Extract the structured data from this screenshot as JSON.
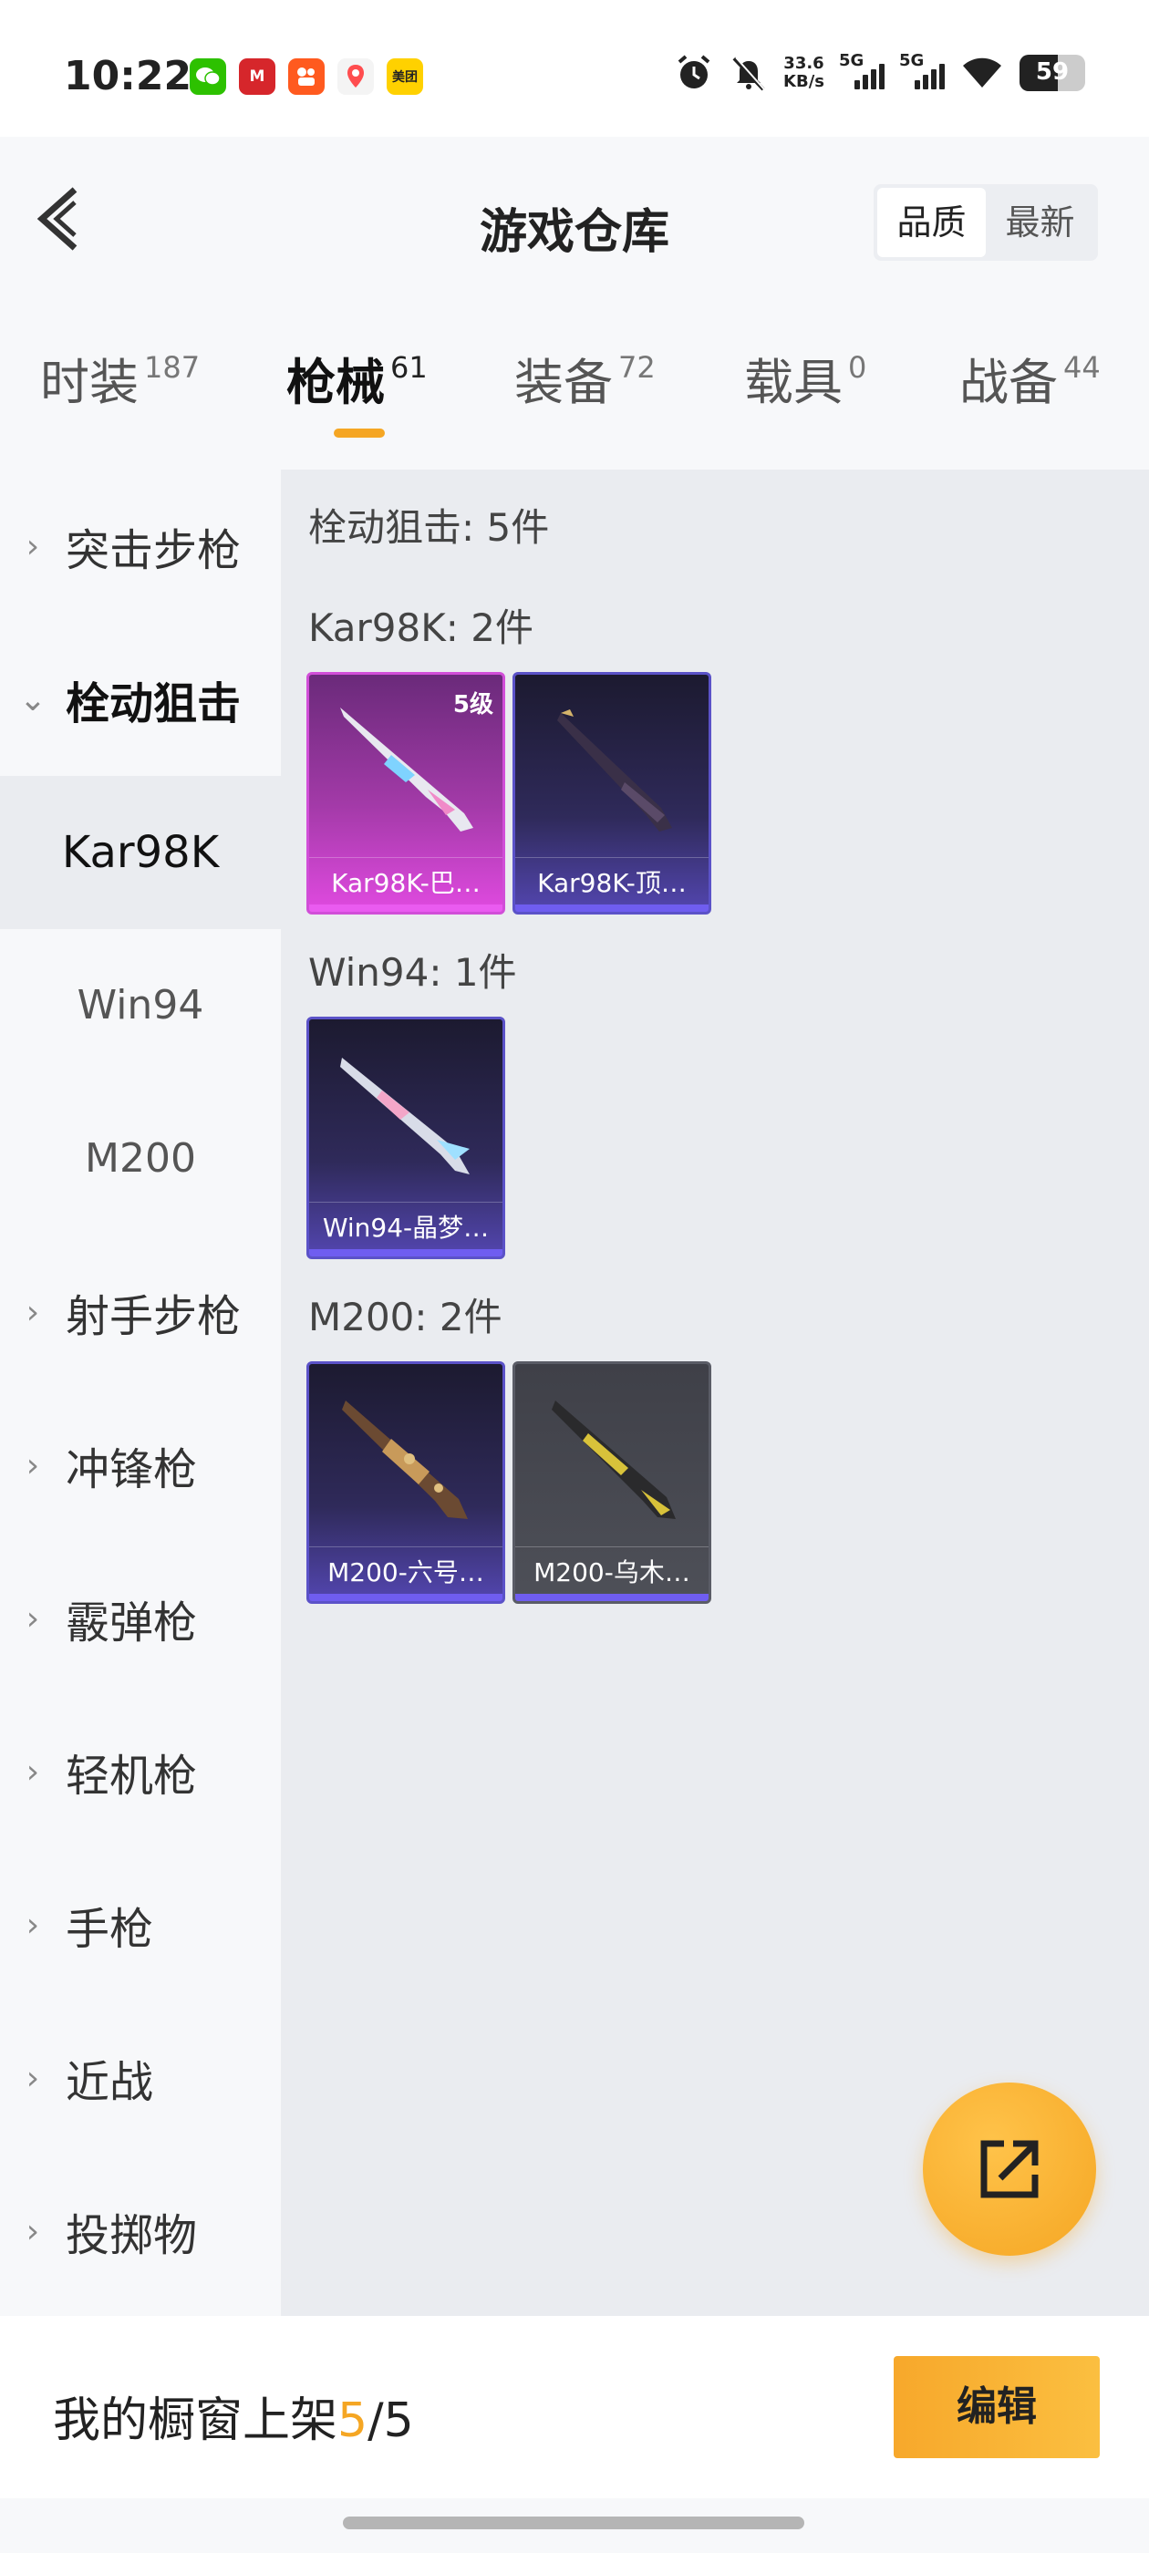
{
  "status_bar": {
    "time": "10:22",
    "apps": [
      {
        "name": "wechat-icon",
        "text": "",
        "color": "#2dc100"
      },
      {
        "name": "metro-icon",
        "text": "M",
        "color": "#d6262b"
      },
      {
        "name": "kuaishou-icon",
        "text": "",
        "color": "#ff5a1f"
      },
      {
        "name": "location-app-icon",
        "text": "",
        "color": "#ff4d4f"
      },
      {
        "name": "meituan-icon",
        "text": "美团",
        "color": "#ffd100"
      }
    ],
    "net_speed_value": "33.6",
    "net_speed_unit": "KB/s",
    "signal_label_1": "5G",
    "signal_label_2": "5G",
    "battery": "59"
  },
  "header": {
    "title": "游戏仓库",
    "sort_options": [
      "品质",
      "最新"
    ],
    "sort_selected": "品质"
  },
  "tabs": [
    {
      "label": "时装",
      "count": "187"
    },
    {
      "label": "枪械",
      "count": "61"
    },
    {
      "label": "装备",
      "count": "72"
    },
    {
      "label": "载具",
      "count": "0"
    },
    {
      "label": "战备",
      "count": "44"
    }
  ],
  "sidebar": {
    "cat_assault": "突击步枪",
    "cat_bolt": "栓动狙击",
    "sub_kar98k": "Kar98K",
    "sub_win94": "Win94",
    "sub_m200": "M200",
    "cat_marksman": "射手步枪",
    "cat_smg": "冲锋枪",
    "cat_shotgun": "霰弹枪",
    "cat_lmg": "轻机枪",
    "cat_pistol": "手枪",
    "cat_melee": "近战",
    "cat_throwable": "投掷物"
  },
  "content": {
    "title": "栓动狙击: 5件",
    "groups": [
      {
        "title": "Kar98K: 2件",
        "items": [
          {
            "name": "Kar98K-巴…",
            "level": "5级",
            "rarity": "pink"
          },
          {
            "name": "Kar98K-顶…",
            "level": "",
            "rarity": "purple"
          }
        ]
      },
      {
        "title": "Win94: 1件",
        "items": [
          {
            "name": "Win94-晶梦…",
            "level": "",
            "rarity": "purple"
          }
        ]
      },
      {
        "title": "M200: 2件",
        "items": [
          {
            "name": "M200-六号…",
            "level": "",
            "rarity": "purple"
          },
          {
            "name": "M200-乌木…",
            "level": "",
            "rarity": "gray"
          }
        ]
      }
    ]
  },
  "bottom_bar": {
    "shelf_label": "我的橱窗上架",
    "shelf_count": "5",
    "shelf_total": "/5",
    "edit_label": "编辑"
  },
  "colors": {
    "accent": "#f5a623",
    "rarity_pink": "#d14ed8",
    "rarity_purple": "#5b52c8"
  }
}
